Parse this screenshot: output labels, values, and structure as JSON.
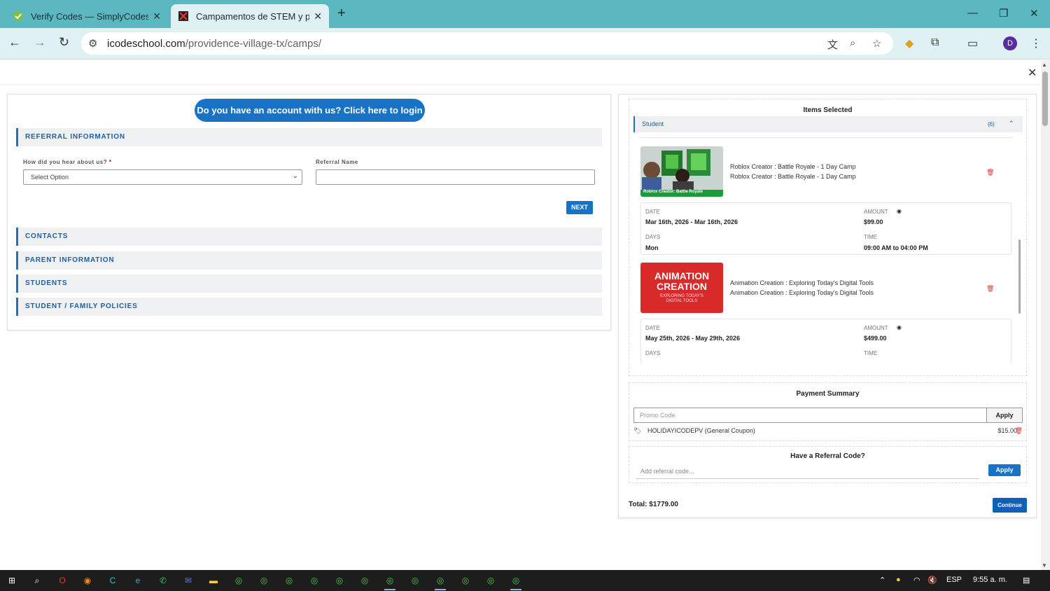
{
  "browser": {
    "tabs": [
      {
        "title": "Verify Codes — SimplyCodes",
        "close": "✕"
      },
      {
        "title": "Campamentos de STEM y programas",
        "close": "✕"
      }
    ],
    "new_tab": "+",
    "url_domain": "icodeschool.com",
    "url_path": "/providence-village-tx/camps/",
    "profile_initial": "D"
  },
  "page": {
    "close_label": "✕",
    "login_button": "Do you have an account with us? Click here to login",
    "sections": {
      "referral": "REFERRAL INFORMATION",
      "contacts": "CONTACTS",
      "parent": "PARENT INFORMATION",
      "students": "STUDENTS",
      "policies": "STUDENT / FAMILY POLICIES"
    },
    "form": {
      "heard_label": "How did you hear about us?",
      "required_mark": "*",
      "heard_value": "Select Option",
      "referral_name_label": "Referral Name",
      "next_button": "NEXT"
    }
  },
  "cart": {
    "title": "Items Selected",
    "student_label": "Student",
    "student_count": "(6)",
    "items": [
      {
        "thumb_caption": "Roblox Creator: Battle Royale",
        "name_line1": "Roblox Creator : Battle Royale - 1 Day Camp",
        "name_line2": "Roblox Creator : Battle Royale - 1 Day Camp",
        "date_label": "DATE",
        "date": "Mar 16th, 2026 - Mar 16th, 2026",
        "amount_label": "AMOUNT",
        "amount": "$99.00",
        "days_label": "DAYS",
        "days": "Mon",
        "time_label": "TIME",
        "time": "09:00 AM to 04:00 PM"
      },
      {
        "thumb_title": "ANIMATION CREATION",
        "thumb_subtitle": "EXPLORING TODAY'S DIGITAL TOOLS",
        "name_line1": "Animation Creation : Exploring Today's Digital Tools",
        "name_line2": "Animation Creation : Exploring Today's Digital Tools",
        "date_label": "DATE",
        "date": "May 25th, 2026 - May 29th, 2026",
        "amount_label": "AMOUNT",
        "amount": "$499.00",
        "days_label": "DAYS",
        "time_label": "TIME"
      }
    ]
  },
  "payment": {
    "title": "Payment Summary",
    "promo_placeholder": "Promo Code",
    "apply_label": "Apply",
    "coupon_name": "HOLIDAYICODEPV (General Coupon)",
    "coupon_amount": "$15.00"
  },
  "referral_code": {
    "title": "Have a Referral Code?",
    "placeholder": "Add referral code...",
    "apply_label": "Apply"
  },
  "checkout": {
    "total": "Total: $1779.00",
    "continue_label": "Continue"
  },
  "taskbar": {
    "language": "ESP",
    "time": "9:55 a. m."
  },
  "colors": {
    "primary": "#1873c7",
    "tab_bar": "#5bb8c1",
    "danger": "#d33333"
  }
}
